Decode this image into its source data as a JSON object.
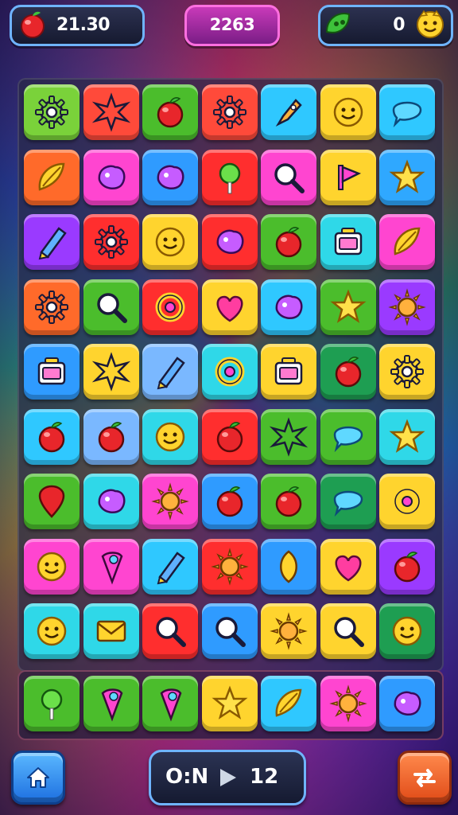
{
  "hud": {
    "left_value": "21.30",
    "left_icon": "red-apple-icon",
    "center_value": "2263",
    "right_value": "0",
    "right_icon_left": "green-leaf-icon",
    "right_icon_right": "smiley-face-icon"
  },
  "board": {
    "rows": [
      [
        {
          "bg": "#7ad23a",
          "icon": "gear"
        },
        {
          "bg": "#ff4a3a",
          "icon": "star-burst"
        },
        {
          "bg": "#4bbd2c",
          "icon": "apple"
        },
        {
          "bg": "#ff4a3a",
          "icon": "gear"
        },
        {
          "bg": "#2fc8ff",
          "icon": "rocket"
        },
        {
          "bg": "#ffd42e",
          "icon": "smiley"
        },
        {
          "bg": "#2fc8ff",
          "icon": "bubble"
        }
      ],
      [
        {
          "bg": "#ff6a2a",
          "icon": "leaf-swirl"
        },
        {
          "bg": "#ff45d0",
          "icon": "blob"
        },
        {
          "bg": "#2f9bff",
          "icon": "blob"
        },
        {
          "bg": "#ff2e2e",
          "icon": "lollipop"
        },
        {
          "bg": "#ff45d0",
          "icon": "magnifier"
        },
        {
          "bg": "#ffd42e",
          "icon": "flag"
        },
        {
          "bg": "#2fa8ff",
          "icon": "star"
        }
      ],
      [
        {
          "bg": "#9a3aff",
          "icon": "crayon"
        },
        {
          "bg": "#ff2e2e",
          "icon": "gear"
        },
        {
          "bg": "#ffd42e",
          "icon": "smiley"
        },
        {
          "bg": "#ff2e2e",
          "icon": "blob"
        },
        {
          "bg": "#4bbd2c",
          "icon": "apple"
        },
        {
          "bg": "#2fd8e8",
          "icon": "box"
        },
        {
          "bg": "#ff45d0",
          "icon": "leaf-swirl"
        }
      ],
      [
        {
          "bg": "#ff6a2a",
          "icon": "gear"
        },
        {
          "bg": "#4bbd2c",
          "icon": "magnifier"
        },
        {
          "bg": "#ff2e2e",
          "icon": "ring"
        },
        {
          "bg": "#ffd42e",
          "icon": "heart"
        },
        {
          "bg": "#2fc8ff",
          "icon": "blob"
        },
        {
          "bg": "#4bbd2c",
          "icon": "star"
        },
        {
          "bg": "#9a3aff",
          "icon": "sun"
        }
      ],
      [
        {
          "bg": "#2f9bff",
          "icon": "box"
        },
        {
          "bg": "#ffd42e",
          "icon": "star-burst"
        },
        {
          "bg": "#7ab8ff",
          "icon": "crayon"
        },
        {
          "bg": "#2fd8e8",
          "icon": "ring"
        },
        {
          "bg": "#ffd42e",
          "icon": "box"
        },
        {
          "bg": "#1e9e52",
          "icon": "apple"
        },
        {
          "bg": "#ffd42e",
          "icon": "gear"
        }
      ],
      [
        {
          "bg": "#2fc8ff",
          "icon": "apple"
        },
        {
          "bg": "#7ab8ff",
          "icon": "apple"
        },
        {
          "bg": "#2fd8e8",
          "icon": "smiley"
        },
        {
          "bg": "#ff2e2e",
          "icon": "apple"
        },
        {
          "bg": "#4bbd2c",
          "icon": "star-burst"
        },
        {
          "bg": "#4bbd2c",
          "icon": "bubble"
        },
        {
          "bg": "#2fd8e8",
          "icon": "star"
        }
      ],
      [
        {
          "bg": "#4bbd2c",
          "icon": "pin"
        },
        {
          "bg": "#2fd8e8",
          "icon": "blob"
        },
        {
          "bg": "#ff45d0",
          "icon": "sun"
        },
        {
          "bg": "#2f9bff",
          "icon": "apple"
        },
        {
          "bg": "#4bbd2c",
          "icon": "apple"
        },
        {
          "bg": "#1e9e52",
          "icon": "bubble"
        },
        {
          "bg": "#ffd42e",
          "icon": "ring"
        }
      ],
      [
        {
          "bg": "#ff45d0",
          "icon": "smiley"
        },
        {
          "bg": "#ff45d0",
          "icon": "cone"
        },
        {
          "bg": "#2fc8ff",
          "icon": "crayon"
        },
        {
          "bg": "#ff2e2e",
          "icon": "sun"
        },
        {
          "bg": "#2f9bff",
          "icon": "leaf"
        },
        {
          "bg": "#ffd42e",
          "icon": "heart"
        },
        {
          "bg": "#9a3aff",
          "icon": "apple"
        }
      ],
      [
        {
          "bg": "#2fd8e8",
          "icon": "smiley"
        },
        {
          "bg": "#2fd8e8",
          "icon": "envelope"
        },
        {
          "bg": "#ff2e2e",
          "icon": "magnifier"
        },
        {
          "bg": "#2f9bff",
          "icon": "magnifier"
        },
        {
          "bg": "#ffd42e",
          "icon": "sun"
        },
        {
          "bg": "#ffd42e",
          "icon": "magnifier"
        },
        {
          "bg": "#1e9e52",
          "icon": "smiley"
        }
      ]
    ]
  },
  "tray": {
    "items": [
      {
        "bg": "#4bbd2c",
        "icon": "lollipop"
      },
      {
        "bg": "#4bbd2c",
        "icon": "cone"
      },
      {
        "bg": "#4bbd2c",
        "icon": "cone"
      },
      {
        "bg": "#ffd42e",
        "icon": "star"
      },
      {
        "bg": "#2fc8ff",
        "icon": "leaf-swirl"
      },
      {
        "bg": "#ff45d0",
        "icon": "sun"
      },
      {
        "bg": "#2f9bff",
        "icon": "blob"
      }
    ]
  },
  "footer": {
    "home_icon": "home-icon",
    "moves_left": "O:N",
    "moves_right": "12",
    "play_icon": "play-icon",
    "shuffle_icon": "shuffle-icon"
  }
}
